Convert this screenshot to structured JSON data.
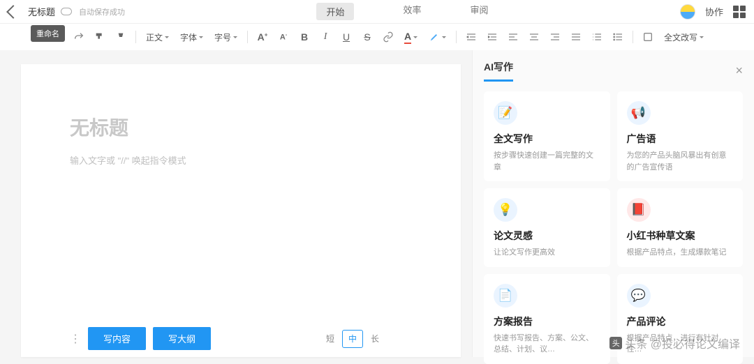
{
  "top": {
    "docname": "无标题",
    "save": "自动保存成功",
    "rename_tip": "重命名",
    "nav": [
      "开始",
      "效率",
      "审阅"
    ],
    "collab": "协作"
  },
  "toolbar": {
    "style": "正文",
    "font": "字体",
    "size": "字号",
    "rewrite": "全文改写"
  },
  "editor": {
    "title_ph": "无标题",
    "body_ph": "输入文字或 \"//\" 唤起指令模式",
    "btn_content": "写内容",
    "btn_outline": "写大纲",
    "seg": [
      "短",
      "中",
      "长"
    ]
  },
  "panel": {
    "title": "AI写作",
    "cards": [
      {
        "icon": "📝",
        "t": "全文写作",
        "d": "按步骤快速创建一篇完整的文章"
      },
      {
        "icon": "📢",
        "t": "广告语",
        "d": "为您的产品头脑风暴出有创意的广告宣传语"
      },
      {
        "icon": "💡",
        "t": "论文灵感",
        "d": "让论文写作更高效"
      },
      {
        "icon": "📕",
        "t": "小红书种草文案",
        "d": "根据产品特点，生成爆款笔记",
        "red": true
      },
      {
        "icon": "📄",
        "t": "方案报告",
        "d": "快速书写报告、方案、公文、总结、计划、议…"
      },
      {
        "icon": "💬",
        "t": "产品评论",
        "d": "根据产品特点，进行有针对性…"
      }
    ]
  },
  "watermark": "头条 @投必得论文编译"
}
